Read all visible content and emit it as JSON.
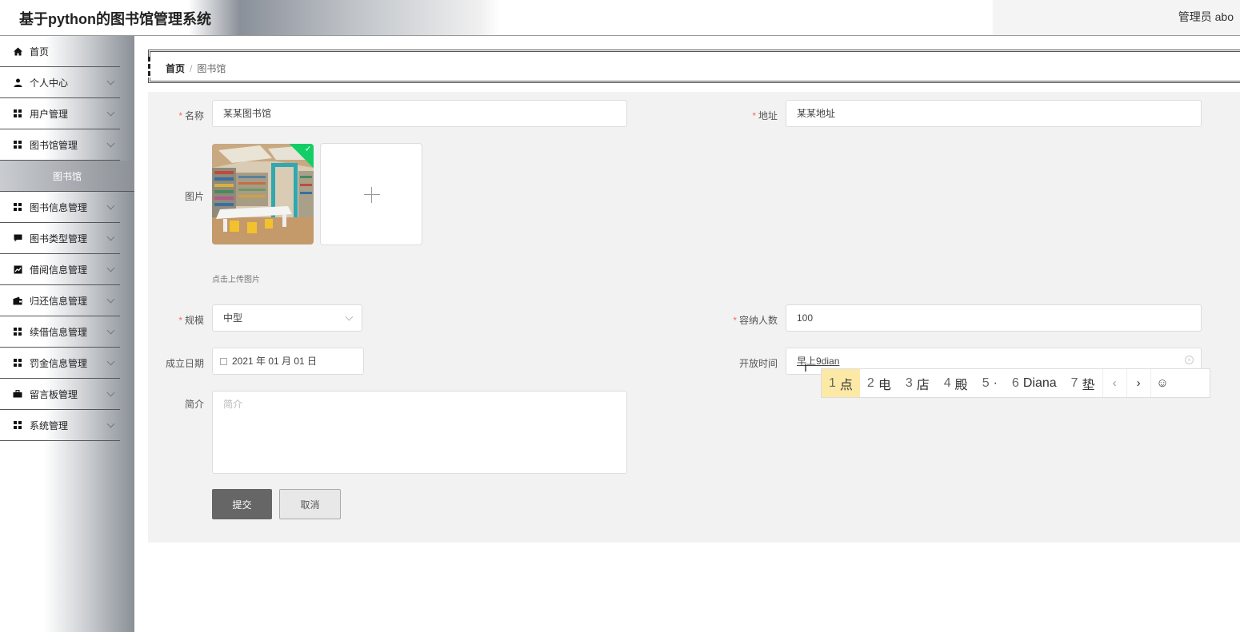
{
  "header": {
    "title": "基于python的图书馆管理系统",
    "user": "管理员 abo"
  },
  "sidebar": {
    "items": [
      {
        "label": "首页",
        "icon": "home-icon",
        "chevron": false
      },
      {
        "label": "个人中心",
        "icon": "user-icon",
        "chevron": true
      },
      {
        "label": "用户管理",
        "icon": "grid-icon",
        "chevron": true
      },
      {
        "label": "图书馆管理",
        "icon": "grid-icon",
        "chevron": true
      },
      {
        "label": "图书馆",
        "icon": "",
        "chevron": false,
        "sub": true
      },
      {
        "label": "图书信息管理",
        "icon": "grid-icon",
        "chevron": true
      },
      {
        "label": "图书类型管理",
        "icon": "comment-icon",
        "chevron": true
      },
      {
        "label": "借阅信息管理",
        "icon": "chart-icon",
        "chevron": true
      },
      {
        "label": "归还信息管理",
        "icon": "wallet-icon",
        "chevron": true
      },
      {
        "label": "续借信息管理",
        "icon": "grid-icon",
        "chevron": true
      },
      {
        "label": "罚金信息管理",
        "icon": "grid-icon",
        "chevron": true
      },
      {
        "label": "留言板管理",
        "icon": "briefcase-icon",
        "chevron": true
      },
      {
        "label": "系统管理",
        "icon": "grid-icon",
        "chevron": true
      }
    ]
  },
  "breadcrumb": {
    "home": "首页",
    "separator": "/",
    "current": "图书馆"
  },
  "form": {
    "name_label": "名称",
    "name_value": "某某图书馆",
    "address_label": "地址",
    "address_value": "某某地址",
    "image_label": "图片",
    "upload_hint": "点击上传图片",
    "scale_label": "规模",
    "scale_value": "中型",
    "capacity_label": "容纳人数",
    "capacity_value": "100",
    "date_label": "成立日期",
    "date_value": "2021 年 01 月 01 日",
    "open_label": "开放时间",
    "open_value": "早上9dian",
    "intro_label": "简介",
    "intro_placeholder": "简介",
    "submit_label": "提交",
    "cancel_label": "取消"
  },
  "ime": {
    "candidates": [
      {
        "num": "1",
        "text": "点"
      },
      {
        "num": "2",
        "text": "电"
      },
      {
        "num": "3",
        "text": "店"
      },
      {
        "num": "4",
        "text": "殿"
      },
      {
        "num": "5",
        "text": "·"
      },
      {
        "num": "6",
        "text": "Diana"
      },
      {
        "num": "7",
        "text": "垫"
      }
    ],
    "prev": "‹",
    "next": "›",
    "emoji": "☺"
  }
}
